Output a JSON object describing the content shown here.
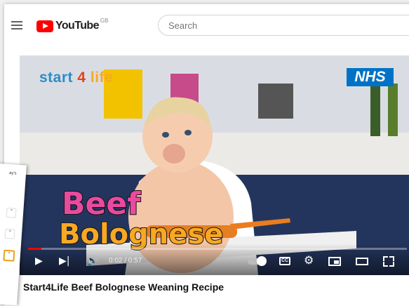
{
  "header": {
    "logo_text": "YouTube",
    "region": "GB",
    "search_placeholder": "Search"
  },
  "video": {
    "brand_start": "start",
    "brand_four": "4",
    "brand_life": "life",
    "nhs_label": "NHS",
    "overlay_line1": "Beef",
    "overlay_line2": "Bolognese",
    "time": "0:02 / 0:57",
    "progress_fraction": 0.035,
    "title": "Start4Life Beef Bolognese Weaning Recipe"
  },
  "side_panel": {
    "text_top": "ay's",
    "text_bottom_1": "o",
    "text_bottom_2": "by"
  }
}
